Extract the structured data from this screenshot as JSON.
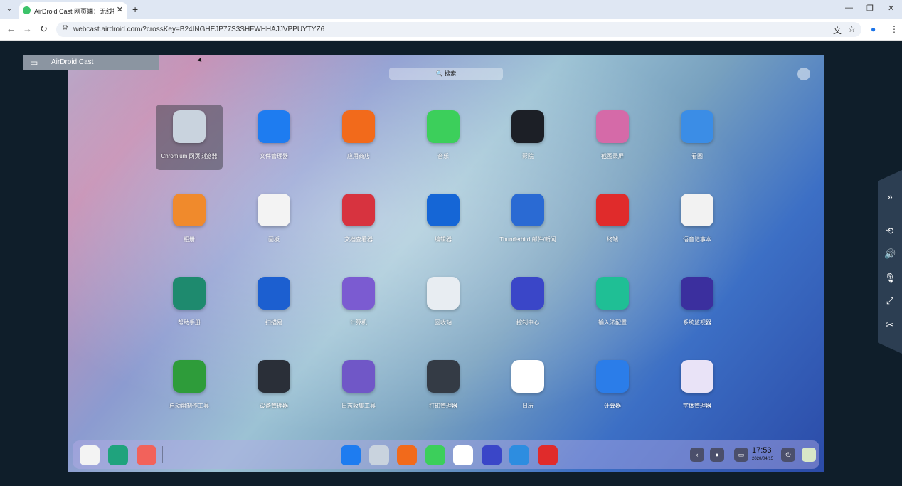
{
  "browser": {
    "tab_title": "AirDroid Cast 网页端：无线投",
    "url": "webcast.airdroid.com/?crossKey=B24INGHEJP77S3SHFWHHAJJVPPUYTYZ6",
    "new_tab": "+",
    "close_tab": "✕",
    "minimize": "—",
    "restore": "❐",
    "close": "✕",
    "back": "←",
    "forward": "→",
    "reload": "↻",
    "tab_menu": "⌄"
  },
  "cast_bar": {
    "label": "AirDroid Cast"
  },
  "screen": {
    "search_placeholder": "🔍 搜索",
    "apps": [
      {
        "label": "Chromium 网页浏览器",
        "icon": "chromium-icon",
        "color": "#c9d3de",
        "selected": true
      },
      {
        "label": "文件管理器",
        "icon": "folder-icon",
        "color": "#1e7cf0"
      },
      {
        "label": "应用商店",
        "icon": "store-icon",
        "color": "#f26a1b"
      },
      {
        "label": "音乐",
        "icon": "music-icon",
        "color": "#3ccf5b"
      },
      {
        "label": "影院",
        "icon": "video-icon",
        "color": "#1c1f26"
      },
      {
        "label": "截图录屏",
        "icon": "camera-icon",
        "color": "#d56aa8"
      },
      {
        "label": "看图",
        "icon": "image-viewer-icon",
        "color": "#3b8de6"
      },
      {
        "label": "相册",
        "icon": "album-icon",
        "color": "#f08a2c"
      },
      {
        "label": "画板",
        "icon": "paint-icon",
        "color": "#f3f3f3"
      },
      {
        "label": "文档查看器",
        "icon": "doc-viewer-icon",
        "color": "#d7333f"
      },
      {
        "label": "编辑器",
        "icon": "editor-icon",
        "color": "#1566d6"
      },
      {
        "label": "Thunderbird 邮件/新闻",
        "icon": "thunderbird-icon",
        "color": "#2a6ad3"
      },
      {
        "label": "终端",
        "icon": "terminal-icon",
        "color": "#e02b2b"
      },
      {
        "label": "语音记事本",
        "icon": "voice-note-icon",
        "color": "#f2f2f2"
      },
      {
        "label": "帮助手册",
        "icon": "manual-icon",
        "color": "#1e8a6e"
      },
      {
        "label": "扫描易",
        "icon": "scanner-icon",
        "color": "#1c5fd0"
      },
      {
        "label": "计算机",
        "icon": "computer-icon",
        "color": "#7b5bd1"
      },
      {
        "label": "回收站",
        "icon": "trash-icon",
        "color": "#e8edf2"
      },
      {
        "label": "控制中心",
        "icon": "control-center-icon",
        "color": "#3a46c8"
      },
      {
        "label": "输入法配置",
        "icon": "input-method-icon",
        "color": "#1fbf95"
      },
      {
        "label": "系统监视器",
        "icon": "system-monitor-icon",
        "color": "#3b2f9e"
      },
      {
        "label": "启动盘制作工具",
        "icon": "boot-maker-icon",
        "color": "#2e9c3a"
      },
      {
        "label": "设备管理器",
        "icon": "device-manager-icon",
        "color": "#2a2f38"
      },
      {
        "label": "日志收集工具",
        "icon": "log-collector-icon",
        "color": "#7057c7"
      },
      {
        "label": "打印管理器",
        "icon": "printer-icon",
        "color": "#343b45"
      },
      {
        "label": "日历",
        "icon": "calendar-icon",
        "color": "#ffffff"
      },
      {
        "label": "计算器",
        "icon": "calculator-icon",
        "color": "#2b7de9"
      },
      {
        "label": "字体管理器",
        "icon": "font-manager-icon",
        "color": "#e9e3f7"
      }
    ],
    "dock": {
      "left_icons": [
        {
          "icon": "launcher-icon",
          "color": "#f3f3f3"
        },
        {
          "icon": "multitask-icon",
          "color": "#1fa37d"
        },
        {
          "icon": "desktop-icon",
          "color": "#f2625b"
        }
      ],
      "center_icons": [
        {
          "icon": "folder-icon",
          "color": "#1e7cf0"
        },
        {
          "icon": "chromium-icon",
          "color": "#c9d3de"
        },
        {
          "icon": "store-icon",
          "color": "#f26a1b"
        },
        {
          "icon": "music-icon",
          "color": "#3ccf5b"
        },
        {
          "icon": "calendar-icon",
          "color": "#ffffff"
        },
        {
          "icon": "control-center-icon",
          "color": "#3a46c8"
        },
        {
          "icon": "vscode-icon",
          "color": "#2d8de0"
        },
        {
          "icon": "terminal-icon",
          "color": "#e02b2b"
        }
      ],
      "time": "17:53",
      "date": "2020/04/15",
      "tray_back": "‹",
      "tray_record": "●",
      "tray_window": "▭",
      "tray_power": "⏻"
    }
  },
  "side_panel": {
    "expand": "»",
    "rotate": "⟲",
    "sound": "🔊",
    "mic": "🎙",
    "fullscreen": "⤢",
    "disconnect": "✂"
  }
}
